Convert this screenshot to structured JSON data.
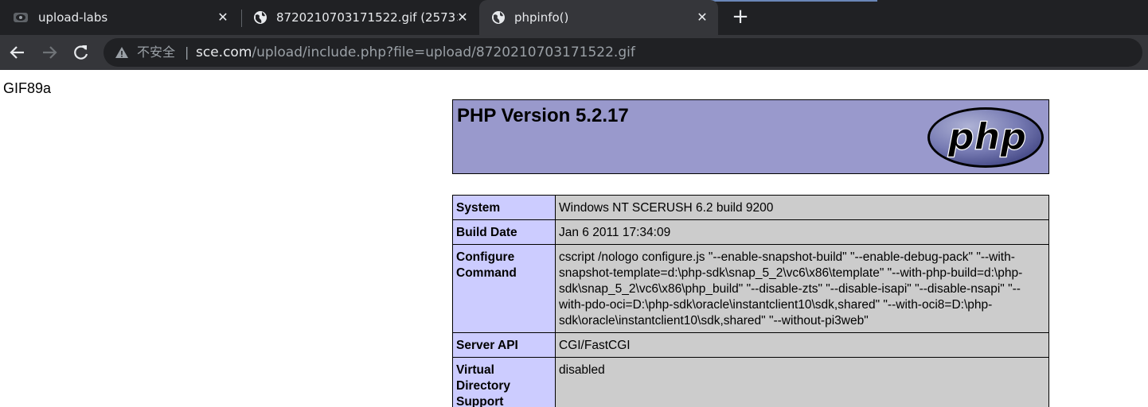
{
  "browser": {
    "tabs": [
      {
        "title": "upload-labs",
        "active": false,
        "icon": "upload-labs-favicon"
      },
      {
        "title": "8720210703171522.gif (2573×",
        "active": false,
        "icon": "globe-icon"
      },
      {
        "title": "phpinfo()",
        "active": true,
        "icon": "globe-icon"
      }
    ],
    "close_glyph": "✕",
    "new_tab_glyph": "+",
    "address": {
      "security_label": "不安全",
      "separator": "|",
      "host": "sce.com",
      "path": "/upload/include.php?file=upload/8720210703171522.gif"
    }
  },
  "page": {
    "gif_header": "GIF89a",
    "php_version_title": "PHP Version 5.2.17",
    "logo_text": "php",
    "info_rows": [
      {
        "key": "System",
        "value": "Windows NT SCERUSH 6.2 build 9200"
      },
      {
        "key": "Build Date",
        "value": "Jan 6 2011 17:34:09"
      },
      {
        "key": "Configure Command",
        "value": "cscript /nologo configure.js \"--enable-snapshot-build\" \"--enable-debug-pack\" \"--with-snapshot-template=d:\\php-sdk\\snap_5_2\\vc6\\x86\\template\" \"--with-php-build=d:\\php-sdk\\snap_5_2\\vc6\\x86\\php_build\" \"--disable-zts\" \"--disable-isapi\" \"--disable-nsapi\" \"--with-pdo-oci=D:\\php-sdk\\oracle\\instantclient10\\sdk,shared\" \"--with-oci8=D:\\php-sdk\\oracle\\instantclient10\\sdk,shared\" \"--without-pi3web\""
      },
      {
        "key": "Server API",
        "value": "CGI/FastCGI"
      },
      {
        "key": "Virtual Directory Support",
        "value": "disabled"
      }
    ]
  },
  "colors": {
    "tabstrip_bg": "#202124",
    "toolbar_bg": "#35363a",
    "php_header_bg": "#9999cc",
    "key_cell_bg": "#ccccff",
    "value_cell_bg": "#cccccc"
  }
}
